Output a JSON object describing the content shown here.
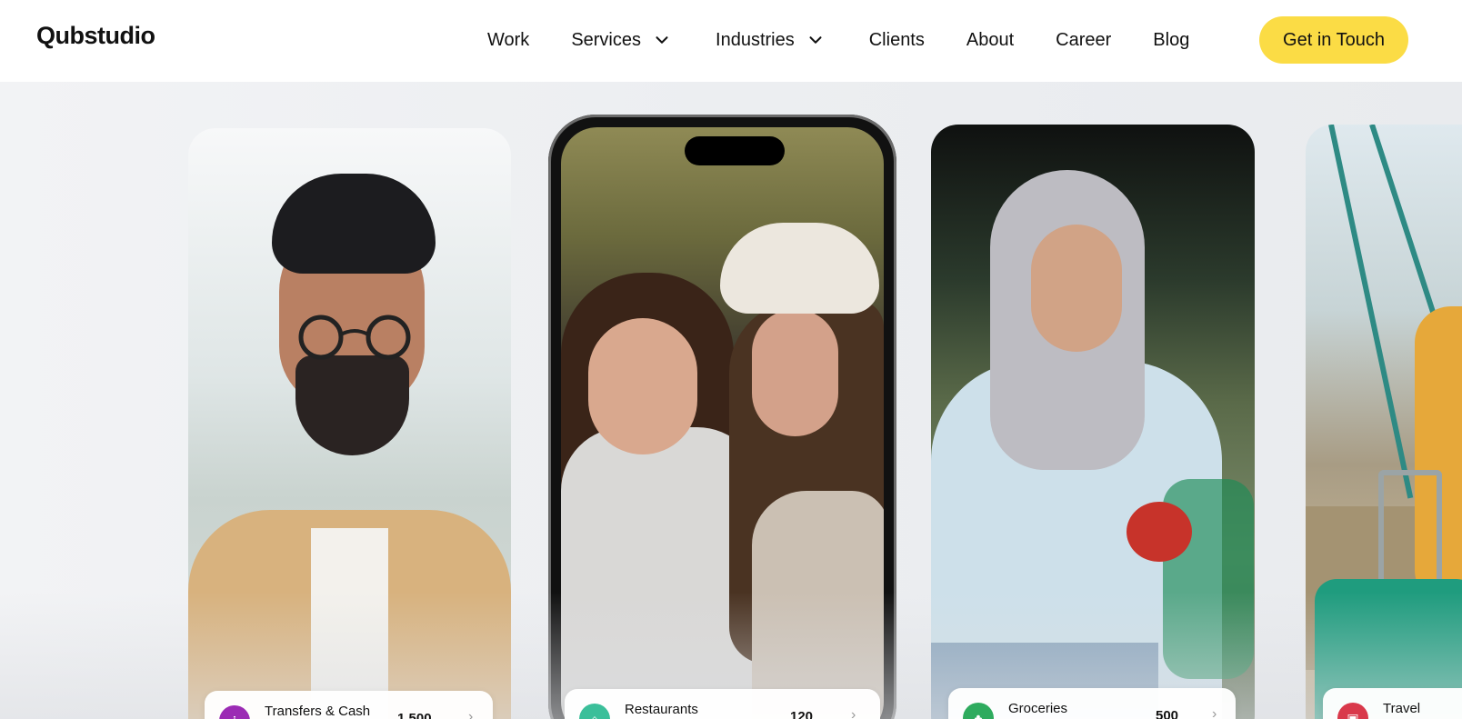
{
  "brand": {
    "logo": "Qubstudio"
  },
  "nav": {
    "items": [
      {
        "label": "Work",
        "has_dropdown": false
      },
      {
        "label": "Services",
        "has_dropdown": true
      },
      {
        "label": "Industries",
        "has_dropdown": true
      },
      {
        "label": "Clients",
        "has_dropdown": false
      },
      {
        "label": "About",
        "has_dropdown": false
      },
      {
        "label": "Career",
        "has_dropdown": false
      },
      {
        "label": "Blog",
        "has_dropdown": false
      }
    ],
    "cta": "Get in Touch"
  },
  "colors": {
    "cta_bg": "#fbdc45",
    "hero_bg": "#eceef1"
  },
  "cards": [
    {
      "category": "Transfers & Cash",
      "amount": "1,500",
      "icon": "transfer-icon",
      "icon_color": "#9b2bb4"
    },
    {
      "category": "Restaurants",
      "amount": "120",
      "icon": "restaurant-icon",
      "icon_color": "#3bbf9a"
    },
    {
      "category": "Groceries",
      "amount": "500",
      "icon": "basket-icon",
      "icon_color": "#2eab5e"
    },
    {
      "category": "Travel",
      "amount": "",
      "icon": "bus-icon",
      "icon_color": "#d9394b"
    }
  ]
}
